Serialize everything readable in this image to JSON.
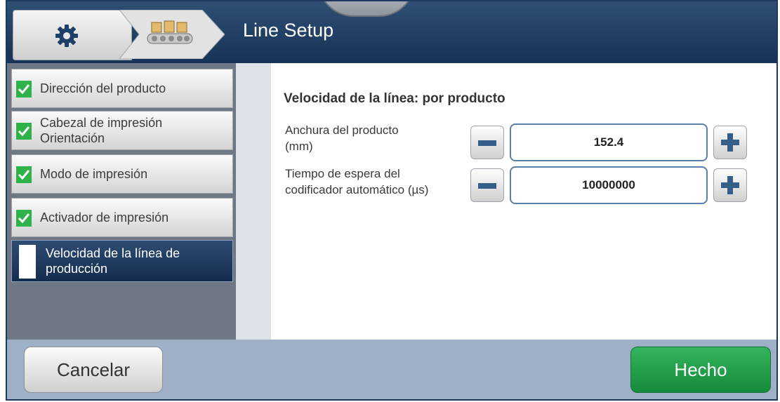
{
  "header": {
    "title": "Line Setup",
    "home_icon": "gear-icon",
    "breadcrumb_icon": "conveyor-icon",
    "top_tab_icon": "chevron-down-icon"
  },
  "sidebar": {
    "items": [
      {
        "label": "Dirección del producto",
        "status": "done"
      },
      {
        "label_line1": "Cabezal de impresión",
        "label_line2": "Orientación",
        "status": "done"
      },
      {
        "label": "Modo de impresión",
        "status": "done"
      },
      {
        "label": "Activador de impresión",
        "status": "done"
      },
      {
        "label_line1": "Velocidad de la línea de",
        "label_line2": "producción",
        "status": "active"
      }
    ]
  },
  "main": {
    "section_title": "Velocidad de la línea: por producto",
    "fields": [
      {
        "label_line1": "Anchura del producto",
        "label_line2": "(mm)",
        "value": "152.4"
      },
      {
        "label_line1": "Tiempo de espera del",
        "label_line2": "codificador automático (µs)",
        "value": "10000000"
      }
    ]
  },
  "footer": {
    "cancel_label": "Cancelar",
    "done_label": "Hecho"
  },
  "colors": {
    "header_bg": "#163256",
    "accent_check": "#2fb24a",
    "done_button": "#1f9c48",
    "sidebar_bg": "#6e7885",
    "footer_bg": "#9fb0c6"
  }
}
